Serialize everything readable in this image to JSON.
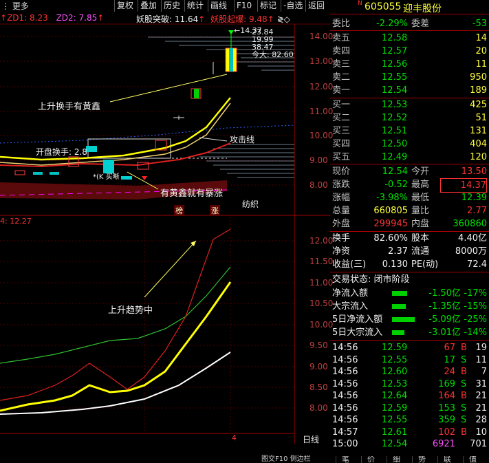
{
  "toolbar": {
    "more": "更多",
    "items": [
      "复权",
      "叠加",
      "历史",
      "统计",
      "画线",
      "F10",
      "标记",
      "-自选",
      "返回"
    ]
  },
  "indicators": {
    "zd1": "ZD1: 8.23",
    "zd2": "ZD2: 7.85",
    "yaogu_tupo": "妖股突破: 11.64",
    "yaogu_qibao": "妖股起爆: 9.48"
  },
  "price_axis": [
    "14.00",
    "13.00",
    "12.00",
    "11.00",
    "10.00",
    "9.00",
    "8.00"
  ],
  "price_labels": {
    "top": "14.37",
    "high_info": [
      "23.84",
      "19.99",
      "38.47",
      "今大: 82.60"
    ],
    "open_turnover": "开盘换手: 2.8",
    "star": "*(K 买晰"
  },
  "annotations": {
    "a1": "上升换手有黄鑫",
    "a2": "攻击线",
    "a3": "有黄鑫就有暴涨",
    "a4": "纺织",
    "a5": "上升趋势中",
    "b1": "榜",
    "b2": "涨"
  },
  "lower": {
    "label": "4: 12.27",
    "axis": [
      "12.00",
      "11.50",
      "11.00",
      "10.50",
      "10.00",
      "9.50",
      "9.00",
      "8.50",
      "8.00"
    ],
    "period": "日线",
    "tick": "4"
  },
  "stock": {
    "badge": "N",
    "code": "605055",
    "name": "迎丰股份"
  },
  "webi": {
    "l1": "委比",
    "v1": "-2.29%",
    "l2": "委差",
    "v2": "-53"
  },
  "asks": [
    {
      "l": "卖五",
      "p": "12.58",
      "v": "14"
    },
    {
      "l": "卖四",
      "p": "12.57",
      "v": "20"
    },
    {
      "l": "卖三",
      "p": "12.56",
      "v": "11"
    },
    {
      "l": "卖二",
      "p": "12.55",
      "v": "950"
    },
    {
      "l": "卖一",
      "p": "12.54",
      "v": "189"
    }
  ],
  "bids": [
    {
      "l": "买一",
      "p": "12.53",
      "v": "425"
    },
    {
      "l": "买二",
      "p": "12.52",
      "v": "51"
    },
    {
      "l": "买三",
      "p": "12.51",
      "v": "131"
    },
    {
      "l": "买四",
      "p": "12.50",
      "v": "404"
    },
    {
      "l": "买五",
      "p": "12.49",
      "v": "120"
    }
  ],
  "quote": [
    {
      "l1": "现价",
      "v1": "12.54",
      "c1": "grn",
      "l2": "今开",
      "v2": "13.50",
      "c2": "red"
    },
    {
      "l1": "涨跌",
      "v1": "-0.52",
      "c1": "grn",
      "l2": "最高",
      "v2": "14.37",
      "c2": "red"
    },
    {
      "l1": "涨幅",
      "v1": "-3.98%",
      "c1": "grn",
      "l2": "最低",
      "v2": "12.39",
      "c2": "grn"
    },
    {
      "l1": "总量",
      "v1": "660805",
      "c1": "yel",
      "l2": "量比",
      "v2": "2.77",
      "c2": "red"
    },
    {
      "l1": "外盘",
      "v1": "299945",
      "c1": "red",
      "l2": "内盘",
      "v2": "360860",
      "c2": "grn"
    }
  ],
  "stats": [
    {
      "l1": "换手",
      "v1": "82.60%",
      "l2": "股本",
      "v2": "4.40亿"
    },
    {
      "l1": "净资",
      "v1": "2.37",
      "l2": "流通",
      "v2": "8000万"
    },
    {
      "l1": "收益(三)",
      "v1": "0.130",
      "l2": "PE(动)",
      "v2": "72.4"
    }
  ],
  "trade_status": "交易状态: 闭市阶段",
  "flows": [
    {
      "l": "净流入额",
      "v": "-1.50亿",
      "p": "-17%",
      "bar": 0.17
    },
    {
      "l": "大宗流入",
      "v": "-1.35亿",
      "p": "-15%",
      "bar": 0.15
    },
    {
      "l": "5日净流入额",
      "v": "-5.09亿",
      "p": "-25%",
      "bar": 0.25
    },
    {
      "l": "5日大宗流入",
      "v": "-3.01亿",
      "p": "-14%",
      "bar": 0.14
    }
  ],
  "ticks": [
    {
      "t": "14:56",
      "p": "12.59",
      "v": "67",
      "s": "B",
      "n": "19"
    },
    {
      "t": "14:56",
      "p": "12.55",
      "v": "17",
      "s": "S",
      "n": "11"
    },
    {
      "t": "14:56",
      "p": "12.60",
      "v": "24",
      "s": "B",
      "n": "7"
    },
    {
      "t": "14:56",
      "p": "12.53",
      "v": "169",
      "s": "S",
      "n": "31"
    },
    {
      "t": "14:56",
      "p": "12.64",
      "v": "164",
      "s": "B",
      "n": "21"
    },
    {
      "t": "14:56",
      "p": "12.59",
      "v": "153",
      "s": "S",
      "n": "21"
    },
    {
      "t": "14:56",
      "p": "12.55",
      "v": "359",
      "s": "S",
      "n": "28"
    },
    {
      "t": "14:57",
      "p": "12.61",
      "v": "102",
      "s": "B",
      "n": "10"
    },
    {
      "t": "15:00",
      "p": "12.54",
      "v": "6921",
      "s": "",
      "n": "701"
    }
  ],
  "bottom_tabs": [
    "笔",
    "价",
    "细",
    "势",
    "联",
    "值"
  ],
  "bottom_left": "图交F10 侧边栏"
}
